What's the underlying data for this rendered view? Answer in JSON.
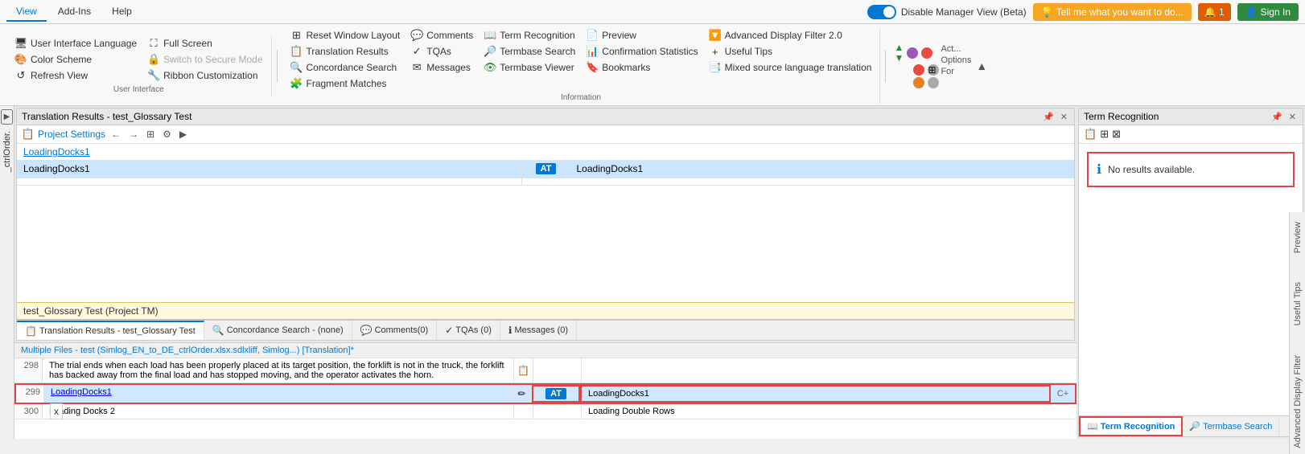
{
  "topbar": {
    "tabs": [
      {
        "label": "View",
        "active": true
      },
      {
        "label": "Add-Ins",
        "active": false
      },
      {
        "label": "Help",
        "active": false
      }
    ],
    "toggle_label": "Disable Manager View (Beta)",
    "help_btn": "Tell me what you want to do...",
    "notif_btn": "1",
    "signin_btn": "Sign In"
  },
  "ribbon": {
    "groups": [
      {
        "name": "user-interface",
        "label": "User Interface",
        "items": [
          {
            "id": "ui-lang",
            "icon": "🖥",
            "label": "User Interface Language"
          },
          {
            "id": "color-scheme",
            "icon": "🎨",
            "label": "Color Scheme"
          },
          {
            "id": "refresh-view",
            "icon": "↺",
            "label": "Refresh View"
          }
        ],
        "col2": [
          {
            "id": "full-screen",
            "icon": "⛶",
            "label": "Full Screen"
          },
          {
            "id": "switch-secure",
            "icon": "🔒",
            "label": "Switch to Secure Mode",
            "disabled": true
          },
          {
            "id": "ribbon-custom",
            "icon": "🔧",
            "label": "Ribbon Customization"
          }
        ]
      },
      {
        "name": "information",
        "label": "Information",
        "items": [
          {
            "id": "reset-layout",
            "icon": "⊞",
            "label": "Reset Window Layout"
          },
          {
            "id": "translation-results",
            "icon": "📋",
            "label": "Translation Results"
          },
          {
            "id": "concordance",
            "icon": "🔍",
            "label": "Concordance Search"
          },
          {
            "id": "fragment-matches",
            "icon": "🧩",
            "label": "Fragment Matches"
          }
        ],
        "col2": [
          {
            "id": "comments",
            "icon": "💬",
            "label": "Comments"
          },
          {
            "id": "tqas",
            "icon": "✓",
            "label": "TQAs"
          },
          {
            "id": "messages",
            "icon": "✉",
            "label": "Messages"
          }
        ],
        "col3": [
          {
            "id": "term-recognition",
            "icon": "📖",
            "label": "Term Recognition"
          },
          {
            "id": "termbase-search",
            "icon": "🔎",
            "label": "Termbase Search"
          },
          {
            "id": "termbase-viewer",
            "icon": "👁",
            "label": "Termbase Viewer"
          }
        ],
        "col4": [
          {
            "id": "preview",
            "icon": "📄",
            "label": "Preview"
          },
          {
            "id": "conf-stats",
            "icon": "📊",
            "label": "Confirmation Statistics"
          },
          {
            "id": "bookmarks",
            "icon": "🔖",
            "label": "Bookmarks"
          }
        ],
        "col5": [
          {
            "id": "adv-filter",
            "icon": "🔽",
            "label": "Advanced Display Filter 2.0"
          },
          {
            "id": "useful-tips",
            "icon": "+",
            "label": "Useful Tips"
          },
          {
            "id": "mixed-source",
            "icon": "📑",
            "label": "Mixed source language translation"
          }
        ]
      }
    ]
  },
  "translation_results": {
    "title": "Translation Results - test_Glossary Test",
    "proj_settings": "Project Settings",
    "breadcrumb": "LoadingDocks1",
    "source_text": "LoadingDocks1",
    "status": "AT",
    "target_text": "LoadingDocks1",
    "tm_bar": "test_Glossary Test (Project TM)"
  },
  "bottom_tabs": [
    {
      "label": "Translation Results - test_Glossary Test",
      "active": true,
      "icon": "📋"
    },
    {
      "label": "Concordance Search - (none)",
      "active": false,
      "icon": "🔍"
    },
    {
      "label": "Comments(0)",
      "active": false,
      "icon": "💬"
    },
    {
      "label": "TQAs (0)",
      "active": false,
      "icon": "✓"
    },
    {
      "label": "Messages (0)",
      "active": false,
      "icon": "ℹ"
    }
  ],
  "bottom_content": {
    "file_bar": "Multiple Files - test (Simlog_EN_to_DE_ctrlOrder.xlsx.sdlxliff, Simlog...) [Translation]*",
    "rows": [
      {
        "num": "298",
        "source": "The trial ends when each load has been properly placed at its target position, the forklift is not in the truck, the forklift has backed away from the final load and has stopped moving, and the operator activates the horn.",
        "status": "",
        "target": "",
        "shortcut": ""
      },
      {
        "num": "299",
        "source": "LoadingDocks1",
        "status": "AT",
        "target": "LoadingDocks1",
        "shortcut": "C+"
      },
      {
        "num": "300",
        "source": "Loading Docks 2",
        "status": "",
        "target": "Loading Double Rows",
        "shortcut": ""
      }
    ]
  },
  "term_recognition": {
    "title": "Term Recognition",
    "no_results": "No results available."
  },
  "bottom_right_tabs": [
    {
      "label": "Term Recognition",
      "active": true,
      "icon": "📖"
    },
    {
      "label": "Termbase Search",
      "active": false,
      "icon": "🔎"
    }
  ],
  "right_vertical_tabs": [
    {
      "label": "Preview"
    },
    {
      "label": "Useful Tips"
    },
    {
      "label": "Advanced Display Filter"
    }
  ],
  "x_label": "x"
}
